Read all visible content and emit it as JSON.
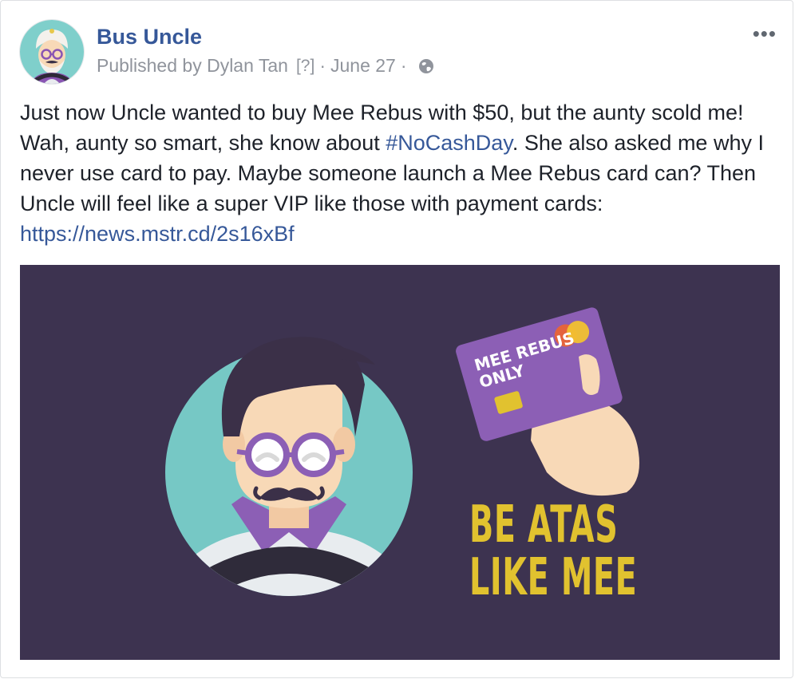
{
  "post": {
    "page_name": "Bus Uncle",
    "author": "Published by Dylan Tan",
    "author_help": "[?]",
    "separator": "·",
    "date": "June 27",
    "separator2": "·",
    "more_label": "•••",
    "text_part1": "Just now Uncle wanted to buy Mee Rebus with $50, but the aunty scold me! Wah, aunty so smart, she know about ",
    "hashtag": "#NoCashDay",
    "text_part2": ". She also asked me why I never use card to pay. Maybe someone launch a Mee Rebus card can? Then Uncle will feel like a super VIP like those with payment cards: ",
    "link": "https://news.mstr.cd/2s16xBf"
  },
  "image": {
    "card_text_line1": "MEE REBUS",
    "card_text_line2": "ONLY",
    "tagline_line1": "BE ATAS",
    "tagline_line2": "LIKE MEE"
  },
  "icons": {
    "avatar": "bus-uncle-avatar-icon",
    "privacy": "globe-icon",
    "more": "more-options-icon"
  },
  "colors": {
    "link": "#365899",
    "text": "#1d2129",
    "meta": "#90949c",
    "image_bg": "#3d3350",
    "accent_yellow": "#e1c22f",
    "card_purple": "#8c5fb5",
    "teal": "#76c8c5"
  }
}
